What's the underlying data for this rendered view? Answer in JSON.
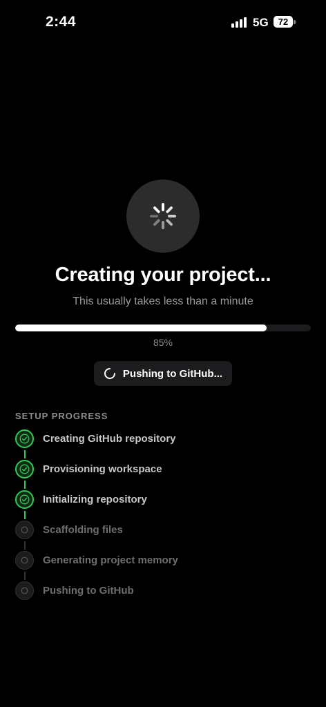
{
  "status_bar": {
    "time": "2:44",
    "network": "5G",
    "battery": "72"
  },
  "loader": {
    "title": "Creating your project...",
    "subtitle": "This usually takes less than a minute",
    "progress_value": 0.85,
    "progress_text": "85%",
    "current_step": "Pushing to GitHub..."
  },
  "setup": {
    "section_title": "SETUP PROGRESS",
    "steps": [
      {
        "label": "Creating GitHub repository",
        "status": "done"
      },
      {
        "label": "Provisioning workspace",
        "status": "done"
      },
      {
        "label": "Initializing repository",
        "status": "done"
      },
      {
        "label": "Scaffolding files",
        "status": "pending"
      },
      {
        "label": "Generating project memory",
        "status": "pending"
      },
      {
        "label": "Pushing to GitHub",
        "status": "pending"
      }
    ]
  },
  "colors": {
    "success": "#2ecc55",
    "background": "#000000",
    "surface": "#1c1c1e"
  }
}
